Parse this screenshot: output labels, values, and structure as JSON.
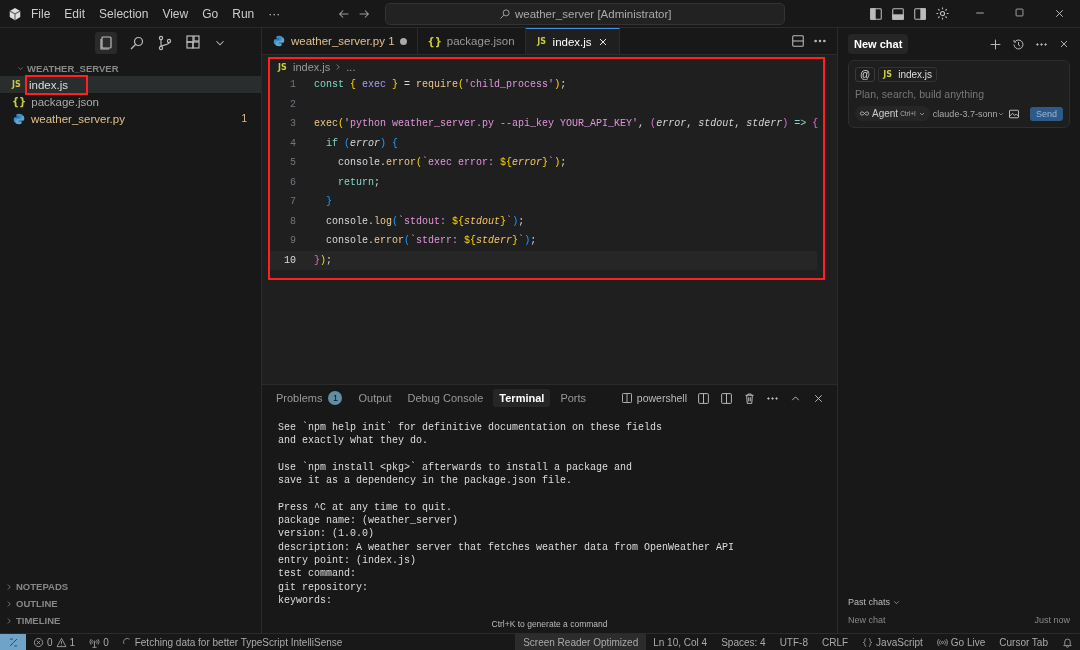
{
  "title_bar": {
    "menu": [
      "File",
      "Edit",
      "Selection",
      "View",
      "Go",
      "Run",
      "···"
    ],
    "search": "weather_server [Administrator]"
  },
  "sidebar": {
    "section": "WEATHER_SERVER",
    "files": [
      {
        "name": "index.js",
        "kind": "js",
        "icon_text": "JS",
        "selected": true,
        "highlighted": true
      },
      {
        "name": "package.json",
        "kind": "json",
        "icon_text": "{}",
        "selected": false,
        "highlighted": false
      },
      {
        "name": "weather_server.py",
        "kind": "py",
        "badge": "1",
        "selected": false,
        "highlighted": false
      }
    ],
    "collapsed_sections": [
      "NOTEPADS",
      "OUTLINE",
      "TIMELINE"
    ]
  },
  "editor": {
    "tabs": [
      {
        "label": "weather_server.py",
        "kind": "py",
        "badge": "1",
        "modified": true,
        "selected": false
      },
      {
        "label": "package.json",
        "kind": "json",
        "icon_text": "{}",
        "modified": false,
        "selected": false
      },
      {
        "label": "index.js",
        "kind": "js",
        "icon_text": "JS",
        "modified": false,
        "selected": true
      }
    ],
    "highlighted": true,
    "breadcrumb": {
      "icon_text": "JS",
      "file": "index.js",
      "rest": "..."
    },
    "lines": [
      {
        "number": "1",
        "tokens": [
          {
            "t": "const ",
            "kind": "kw"
          },
          {
            "t": "{",
            "kind": "br"
          },
          {
            "t": " exec ",
            "kind": "var"
          },
          {
            "t": "}",
            "kind": "br"
          },
          {
            "t": " = ",
            "kind": "p"
          },
          {
            "t": "require",
            "kind": "fn"
          },
          {
            "t": "(",
            "kind": "br"
          },
          {
            "t": "'child_process'",
            "kind": "str"
          },
          {
            "t": ")",
            "kind": "br"
          },
          {
            "t": ";",
            "kind": "p"
          }
        ]
      },
      {
        "number": "2"
      },
      {
        "number": "3",
        "tokens": [
          {
            "t": "exec",
            "kind": "fn"
          },
          {
            "t": "(",
            "kind": "br"
          },
          {
            "t": "'python weather_server.py --api_key YOUR_API_KEY'",
            "kind": "str"
          },
          {
            "t": ", ",
            "kind": "p"
          },
          {
            "t": "(",
            "kind": "br2"
          },
          {
            "t": "error",
            "kind": "param"
          },
          {
            "t": ", ",
            "kind": "p"
          },
          {
            "t": "stdout",
            "kind": "param"
          },
          {
            "t": ", ",
            "kind": "p"
          },
          {
            "t": "stderr",
            "kind": "param"
          },
          {
            "t": ")",
            "kind": "br2"
          },
          {
            "t": " => ",
            "kind": "kw"
          },
          {
            "t": "{",
            "kind": "br2"
          }
        ]
      },
      {
        "number": "4",
        "tokens": [
          {
            "t": "  if ",
            "kind": "kw"
          },
          {
            "t": "(",
            "kind": "br3"
          },
          {
            "t": "error",
            "kind": "param"
          },
          {
            "t": ")",
            "kind": "br3"
          },
          {
            "t": " {",
            "kind": "br3"
          }
        ]
      },
      {
        "number": "5",
        "tokens": [
          {
            "t": "    console.",
            "kind": "p"
          },
          {
            "t": "error",
            "kind": "fn"
          },
          {
            "t": "(",
            "kind": "br"
          },
          {
            "t": "`exec error: ",
            "kind": "str"
          },
          {
            "t": "${",
            "kind": "br"
          },
          {
            "t": "error",
            "kind": "param2"
          },
          {
            "t": "}",
            "kind": "br"
          },
          {
            "t": "`",
            "kind": "str"
          },
          {
            "t": ")",
            "kind": "br"
          },
          {
            "t": ";",
            "kind": "p"
          }
        ]
      },
      {
        "number": "6",
        "tokens": [
          {
            "t": "    return",
            "kind": "kw"
          },
          {
            "t": ";",
            "kind": "p"
          }
        ]
      },
      {
        "number": "7",
        "tokens": [
          {
            "t": "  }",
            "kind": "br3"
          }
        ]
      },
      {
        "number": "8",
        "tokens": [
          {
            "t": "  console.",
            "kind": "p"
          },
          {
            "t": "log",
            "kind": "fn"
          },
          {
            "t": "(",
            "kind": "br3"
          },
          {
            "t": "`stdout: ",
            "kind": "str"
          },
          {
            "t": "${",
            "kind": "br"
          },
          {
            "t": "stdout",
            "kind": "param2"
          },
          {
            "t": "}",
            "kind": "br"
          },
          {
            "t": "`",
            "kind": "str"
          },
          {
            "t": ")",
            "kind": "br3"
          },
          {
            "t": ";",
            "kind": "p"
          }
        ]
      },
      {
        "number": "9",
        "tokens": [
          {
            "t": "  console.",
            "kind": "p"
          },
          {
            "t": "error",
            "kind": "fn"
          },
          {
            "t": "(",
            "kind": "br3"
          },
          {
            "t": "`stderr: ",
            "kind": "str"
          },
          {
            "t": "${",
            "kind": "br"
          },
          {
            "t": "stderr",
            "kind": "param2"
          },
          {
            "t": "}",
            "kind": "br"
          },
          {
            "t": "`",
            "kind": "str"
          },
          {
            "t": ")",
            "kind": "br3"
          },
          {
            "t": ";",
            "kind": "p"
          }
        ]
      },
      {
        "number": "10",
        "current": true,
        "tokens": [
          {
            "t": "}",
            "kind": "br2"
          },
          {
            "t": ")",
            "kind": "br"
          },
          {
            "t": ";",
            "kind": "p"
          }
        ]
      }
    ]
  },
  "panel": {
    "tabs": [
      {
        "label": "Problems",
        "badge": "1",
        "selected": false
      },
      {
        "label": "Output",
        "selected": false
      },
      {
        "label": "Debug Console",
        "selected": false
      },
      {
        "label": "Terminal",
        "selected": true
      },
      {
        "label": "Ports",
        "selected": false
      }
    ],
    "terminal_profile": "powershell",
    "terminal_blocks": [
      [
        "See `npm help init` for definitive documentation on these fields",
        "and exactly what they do."
      ],
      [
        "Use `npm install <pkg>` afterwards to install a package and",
        "save it as a dependency in the package.json file."
      ],
      [
        "Press ^C at any time to quit.",
        "package name: (weather_server)",
        "version: (1.0.0)",
        "description: A weather server that fetches weather data from OpenWeather API",
        "entry point: (index.js)",
        "test command:",
        "git repository:",
        "keywords:"
      ]
    ],
    "hint": "Ctrl+K to generate a command"
  },
  "chat": {
    "title": "New chat",
    "mention": "@",
    "context_file": {
      "icon_text": "JS",
      "name": "index.js"
    },
    "placeholder": "Plan, search, build anything",
    "mode": "Agent",
    "mode_shortcut": "Ctrl+I",
    "model": "claude-3.7-sonn",
    "send": "Send",
    "past_chats_label": "Past chats",
    "past_chats": [
      {
        "title": "New chat",
        "time": "Just now"
      }
    ]
  },
  "status_bar": {
    "errors": "0",
    "warnings": "1",
    "ports": "0",
    "message": "Fetching data for better TypeScript IntelliSense",
    "items": [
      {
        "label": "Screen Reader Optimized",
        "kind": "highlight"
      },
      {
        "label": "Ln 10, Col 4",
        "kind": "plain"
      },
      {
        "label": "Spaces: 4",
        "kind": "plain"
      },
      {
        "label": "UTF-8",
        "kind": "plain"
      },
      {
        "label": "CRLF",
        "kind": "plain"
      },
      {
        "label": "JavaScript",
        "kind": "language"
      },
      {
        "label": "Go Live",
        "kind": "live"
      },
      {
        "label": "Cursor Tab",
        "kind": "plain"
      }
    ]
  }
}
